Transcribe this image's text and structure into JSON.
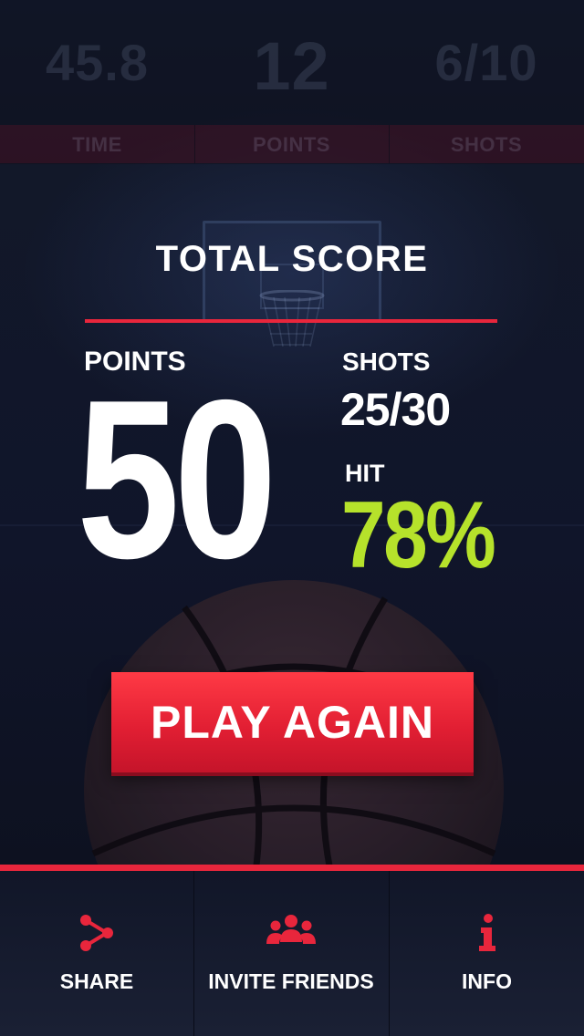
{
  "hud": {
    "time_value": "45.8",
    "points_value": "12",
    "shots_value": "6/10",
    "time_label": "TIME",
    "points_label": "POINTS",
    "shots_label": "SHOTS"
  },
  "score": {
    "title": "TOTAL SCORE",
    "points_label": "POINTS",
    "points_value": "50",
    "shots_label": "SHOTS",
    "shots_value": "25/30",
    "hit_label": "HIT",
    "hit_value": "78%"
  },
  "actions": {
    "play_again_label": "PLAY AGAIN"
  },
  "bottom_nav": {
    "share_label": "SHARE",
    "invite_label": "INVITE FRIENDS",
    "info_label": "INFO",
    "share_icon": "share-icon",
    "invite_icon": "group-icon",
    "info_icon": "info-icon"
  },
  "colors": {
    "accent_red": "#e8263c",
    "hit_green": "#b6e22b",
    "background": "#0b0f1c"
  }
}
